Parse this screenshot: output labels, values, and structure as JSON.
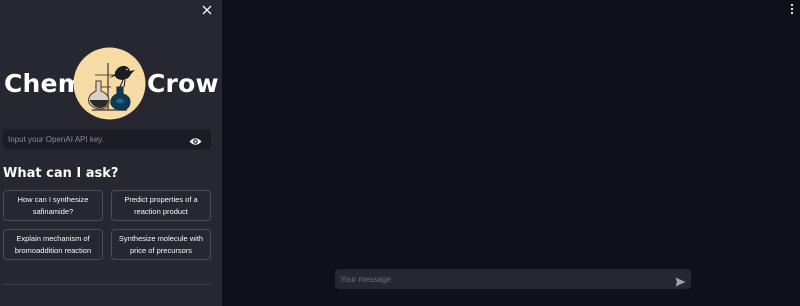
{
  "sidebar": {
    "close_icon": "close-icon",
    "logo": {
      "left_word": "Chem",
      "right_word": "Crow",
      "emblem_icon": "chemcrow-emblem-icon"
    },
    "api_key": {
      "placeholder": "Input your OpenAI API key.",
      "value": "",
      "toggle_icon": "eye-icon"
    },
    "ask_heading": "What can I ask?",
    "suggestions": [
      {
        "label": "How can I synthesize safinamide?"
      },
      {
        "label": "Predict properties of a reaction product"
      },
      {
        "label": "Explain mechanism of bromoaddition reaction"
      },
      {
        "label": "Synthesize molecule with price of precursors"
      }
    ]
  },
  "main": {
    "menu_icon": "more-vertical-icon",
    "chat": {
      "placeholder": "Your message",
      "value": "",
      "send_icon": "send-icon"
    }
  },
  "colors": {
    "main_bg": "#0e1117",
    "sidebar_bg": "#262730",
    "emblem_bg": "#f6dca4",
    "text": "#fafafa"
  }
}
